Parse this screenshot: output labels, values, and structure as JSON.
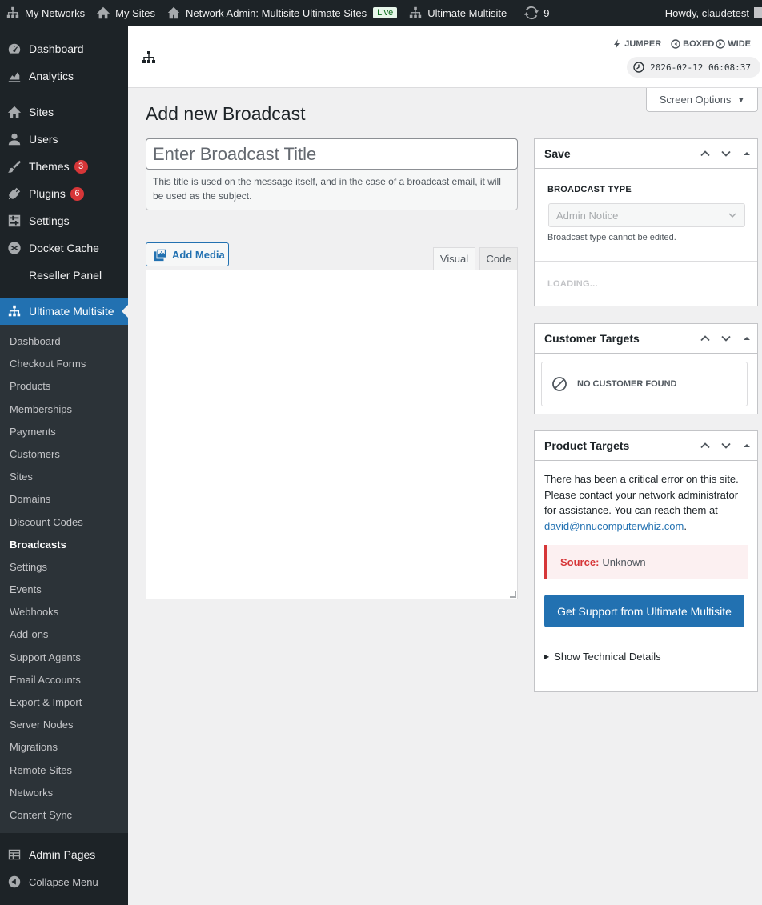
{
  "adminbar": {
    "my_networks": "My Networks",
    "my_sites": "My Sites",
    "network_admin": "Network Admin: Multisite Ultimate Sites",
    "live_badge": "Live",
    "ultimate_multisite": "Ultimate Multisite",
    "updates_count": "9",
    "howdy": "Howdy, claudetest"
  },
  "sidebar": {
    "top_items": [
      {
        "label": "Dashboard",
        "icon": "dashboard-icon"
      },
      {
        "label": "Analytics",
        "icon": "analytics-icon"
      },
      {
        "label": "Sites",
        "icon": "sites-icon"
      },
      {
        "label": "Users",
        "icon": "users-icon"
      },
      {
        "label": "Themes",
        "icon": "themes-icon",
        "badge": "3"
      },
      {
        "label": "Plugins",
        "icon": "plugins-icon",
        "badge": "6"
      },
      {
        "label": "Settings",
        "icon": "settings-icon"
      },
      {
        "label": "Docket Cache",
        "icon": "docket-cache-icon"
      },
      {
        "label": "Reseller Panel",
        "icon": ""
      }
    ],
    "current": {
      "label": "Ultimate Multisite",
      "icon": "network-icon"
    },
    "submenu": [
      "Dashboard",
      "Checkout Forms",
      "Products",
      "Memberships",
      "Payments",
      "Customers",
      "Sites",
      "Domains",
      "Discount Codes",
      "Broadcasts",
      "Settings",
      "Events",
      "Webhooks",
      "Add-ons",
      "Support Agents",
      "Email Accounts",
      "Export & Import",
      "Server Nodes",
      "Migrations",
      "Remote Sites",
      "Networks",
      "Content Sync"
    ],
    "submenu_current": "Broadcasts",
    "bottom_items": [
      {
        "label": "Admin Pages",
        "icon": "admin-pages-icon"
      },
      {
        "label": "Collapse Menu",
        "icon": "collapse-icon"
      }
    ]
  },
  "header": {
    "jumper": "JUMPER",
    "boxed": "BOXED",
    "wide": "WIDE",
    "clock": "2026-02-12 06:08:37"
  },
  "screen_options": "Screen Options",
  "page": {
    "title": "Add new Broadcast",
    "title_placeholder": "Enter Broadcast Title",
    "title_help": "This title is used on the message itself, and in the case of a broadcast email, it will be used as the subject.",
    "add_media": "Add Media",
    "tab_visual": "Visual",
    "tab_code": "Code"
  },
  "save_box": {
    "title": "Save",
    "broadcast_type_label": "BROADCAST TYPE",
    "broadcast_type_value": "Admin Notice",
    "broadcast_type_note": "Broadcast type cannot be edited.",
    "loading": "LOADING..."
  },
  "customer_box": {
    "title": "Customer Targets",
    "empty": "NO CUSTOMER FOUND"
  },
  "product_box": {
    "title": "Product Targets",
    "error_text": "There has been a critical error on this site. Please contact your network administrator for assistance. You can reach them at",
    "email": "david@nnucomputerwhiz.com",
    "period": ".",
    "source_label": "Source:",
    "source_value": "Unknown",
    "support_button": "Get Support from Ultimate Multisite",
    "tech_details": "Show Technical Details"
  },
  "colors": {
    "admin_dark": "#1d2327",
    "accent": "#2271b1",
    "badge_red": "#d63638"
  }
}
